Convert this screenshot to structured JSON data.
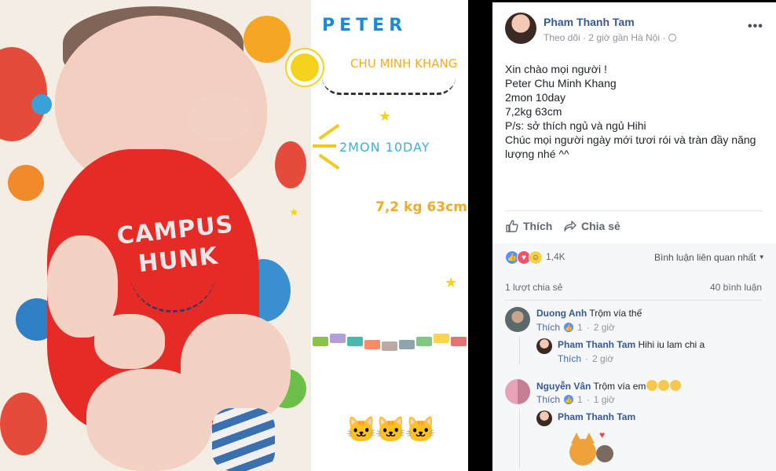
{
  "photo": {
    "shirt_line1": "CAMPUS",
    "shirt_line2": "HUNK",
    "overlay_name": "PETER",
    "overlay_fullname": "CHU MINH KHANG",
    "overlay_age": "2MON 10DAY",
    "overlay_weight": "7,2 kg 63cm"
  },
  "post": {
    "author": "Pham Thanh Tam",
    "follow": "Theo dõi",
    "sep": "·",
    "time": "2 giờ",
    "location_prefix": "gần",
    "location": "Hà Nội",
    "more": "•••",
    "lines": [
      "Xin chào mọi người !",
      "Peter Chu Minh Khang",
      "2mon 10day",
      "7,2kg 63cm",
      "P/s: sở thích ngủ và ngủ Hihi",
      "Chúc mọi người ngày mới tươi rói và tràn đầy năng",
      "lượng nhé ^^"
    ],
    "like_label": "Thích",
    "share_label": "Chia sẻ",
    "reaction_count": "1,4K",
    "relevant_label": "Bình luận liên quan nhất",
    "shares_label": "1 lượt chia sẻ",
    "comments_label": "40 bình luận"
  },
  "comments": [
    {
      "author": "Duong Anh",
      "text": "Trộm vía thế",
      "like_label": "Thích",
      "likes": "1",
      "time": "2 giờ",
      "reply": {
        "author": "Pham Thanh Tam",
        "text": "Hihi iu lam chi a",
        "like_label": "Thích",
        "time": "2 giờ"
      }
    },
    {
      "author": "Nguyễn Vân",
      "text": "Trộm vía em",
      "like_label": "Thích",
      "likes": "1",
      "time": "1 giờ",
      "reply": {
        "author": "Pham Thanh Tam"
      }
    }
  ],
  "colors": {
    "link": "#365899",
    "like_blue": "#4267b2",
    "shirt_red": "#e62b26",
    "overlay_blue": "#1a8ad6",
    "overlay_orange": "#f0ad23"
  }
}
